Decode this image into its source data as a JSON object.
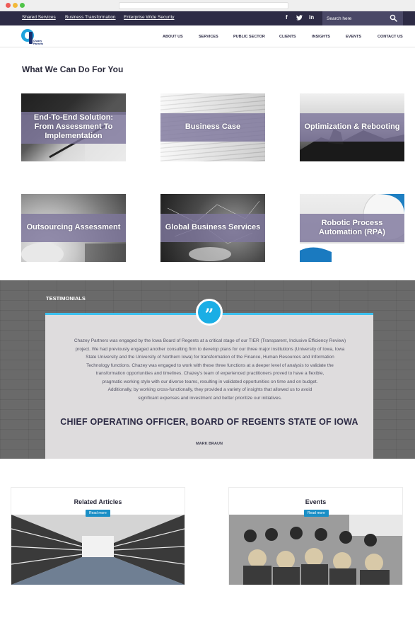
{
  "topbar": {
    "links": [
      "Shared Services",
      "Business Transformation",
      "Enterprise Wide Security"
    ],
    "social": [
      "f",
      "t",
      "in"
    ],
    "search_placeholder": "Search here"
  },
  "logo": {
    "line1": "Chazey",
    "line2": "Partners"
  },
  "nav": [
    "ABOUT US",
    "SERVICES",
    "PUBLIC SECTOR",
    "CLIENTS",
    "INSIGHTS",
    "EVENTS",
    "CONTACT US"
  ],
  "services": {
    "title": "What We Can Do For You",
    "cards": [
      {
        "label_lines": [
          "End-To-End Solution:",
          "From Assessment To",
          "Implementation"
        ]
      },
      {
        "label_lines": [
          "Business Case"
        ]
      },
      {
        "label_lines": [
          "Optimization & Rebooting"
        ]
      },
      {
        "label_lines": [
          "Outsourcing Assessment"
        ]
      },
      {
        "label_lines": [
          "Global Business Services"
        ]
      },
      {
        "label_lines": [
          "Robotic Process",
          "Automation (RPA)"
        ]
      }
    ]
  },
  "testimonials": {
    "heading": "TESTIMONIALS",
    "quote_lines": [
      "Chazey Partners was engaged by the Iowa Board of Regents at a critical stage of our TIER (Transparent, Inclusive Efficiency Review)",
      "project. We had previously engaged another consulting firm to develop plans for our three major institutions (University of Iowa, Iowa",
      "State University and the University of Northern Iowa) for transformation of the Finance, Human Resources and Information",
      "Technology functions. Chazey was engaged to work with these three functions at a deeper level of analysis to validate the",
      "transformation opportunities and timelines. Chazey's team of experienced practitioners proved to have a flexible,",
      "pragmatic working style with our diverse teams, resulting in validated opportunities on time and on budget.",
      "Additionally, by working cross-functionally, they provided a variety of insights that allowed us to avoid",
      "significant expenses and investment and better prioritize our initiatives."
    ],
    "author_title": "CHIEF OPERATING OFFICER, BOARD OF REGENTS STATE OF IOWA",
    "author_name": "MARK BRAUN"
  },
  "panels": {
    "articles": {
      "title": "Related Articles",
      "button": "Read more"
    },
    "events": {
      "title": "Events",
      "button": "Read more"
    }
  }
}
